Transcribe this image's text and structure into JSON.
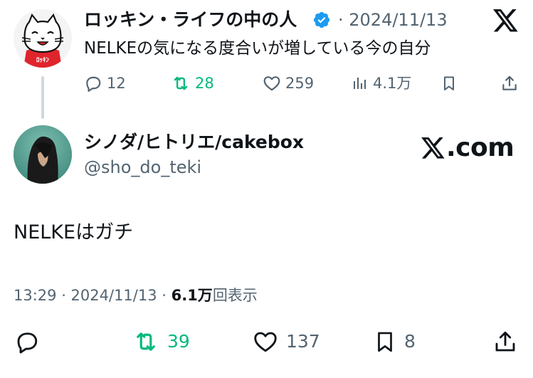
{
  "parent_tweet": {
    "author_name": "ロッキン・ライフの中の人",
    "date": "· 2024/11/13",
    "text": "NELKEの気になる度合いが増している今の自分",
    "actions": {
      "replies": "12",
      "reposts": "28",
      "likes": "259",
      "views": "4.1万"
    }
  },
  "tweet": {
    "author_name": "シノダ/ヒトリエ/cakebox",
    "handle": "@sho_do_teki",
    "brand": ".com",
    "text": "NELKEはガチ",
    "meta": {
      "time_date": "13:29 · 2024/11/13 · ",
      "views_count": "6.1万",
      "views_label": "回表示"
    },
    "actions": {
      "reposts": "39",
      "likes": "137",
      "bookmarks": "8"
    }
  },
  "colors": {
    "text": "#0f1419",
    "muted": "#536471",
    "repost_green": "#00ba7c",
    "verified_blue": "#1d9bf0",
    "cat_shirt_red": "#e0242b"
  },
  "icons": [
    "x-logo",
    "verified-badge",
    "reply-icon",
    "repost-icon",
    "like-icon",
    "views-icon",
    "bookmark-icon",
    "share-icon"
  ]
}
